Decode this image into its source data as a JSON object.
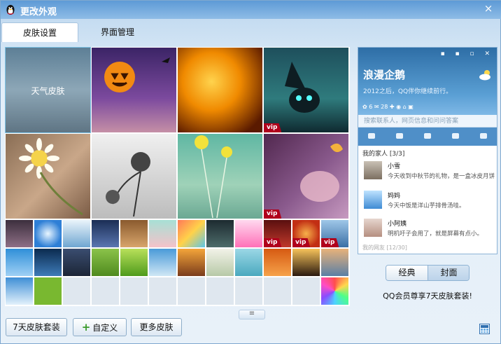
{
  "window": {
    "title": "更改外观",
    "close": "×"
  },
  "tabs": [
    {
      "label": "皮肤设置",
      "active": true
    },
    {
      "label": "界面管理",
      "active": false
    }
  ],
  "grid": {
    "weather_tile_label": "天气皮肤",
    "vip_badge": "vip"
  },
  "preview": {
    "window_buttons": "▪ ▪ ▫ ✕",
    "name": "浪漫企鹅",
    "signature": "2012之后，QQ伴你继续前行。",
    "status_row": "✿ 6  ✉ 28  ✚  ◉  ⌂  ▣",
    "search_placeholder": "搜索联系人，网页信息和问问答案",
    "group_title": "我的家人 [3/3]",
    "contacts": [
      {
        "name": "小雪",
        "message": "今天收到中秋节的礼物，是一盒冰皮月饼"
      },
      {
        "name": "妈妈",
        "message": "今天中饭是洋山芋排骨汤哇。"
      },
      {
        "name": "小阿姨",
        "message": "明机吁子会用了，就是屏幕有点小。"
      }
    ],
    "friends_title": "我的网友 [12/30]"
  },
  "toggle": {
    "classic": "经典",
    "cover": "封面",
    "selected": "classic"
  },
  "promo": "QQ会员尊享7天皮肤套装!",
  "splitter": "≡",
  "buttons": {
    "pack": "7天皮肤套装",
    "custom": "自定义",
    "more": "更多皮肤",
    "plus": "+"
  },
  "colors": {
    "titlebar": "#5d9ad6",
    "vip": "#b0001c",
    "accent": "#4f8fc8"
  }
}
